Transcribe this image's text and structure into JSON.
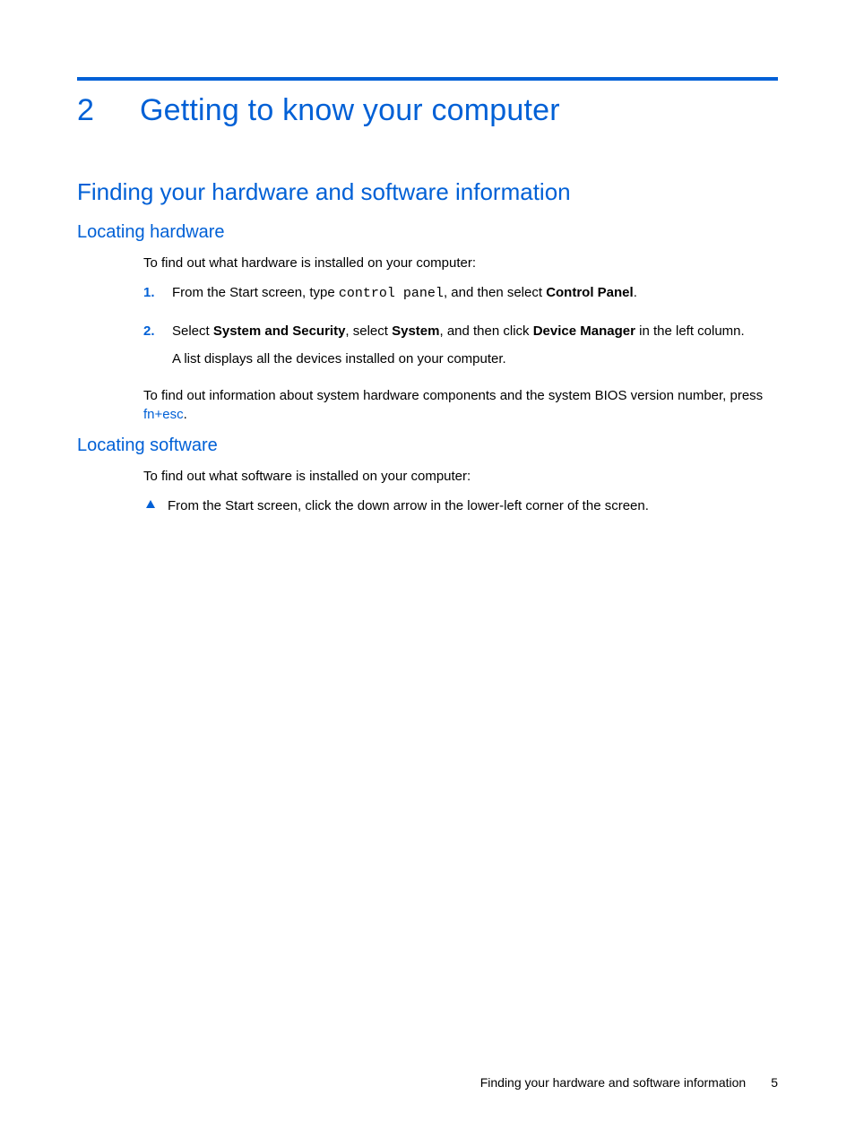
{
  "chapter": {
    "number": "2",
    "title": "Getting to know your computer"
  },
  "section1": {
    "title": "Finding your hardware and software information"
  },
  "sub_hw": {
    "title": "Locating hardware",
    "intro": "To find out what hardware is installed on your computer:",
    "step1_marker": "1.",
    "step1_a": "From the Start screen, type ",
    "step1_code": "control panel",
    "step1_b": ", and then select ",
    "step1_bold": "Control Panel",
    "step1_c": ".",
    "step2_marker": "2.",
    "step2_a": "Select ",
    "step2_b1": "System and Security",
    "step2_b": ", select ",
    "step2_b2": "System",
    "step2_c": ", and then click ",
    "step2_b3": "Device Manager",
    "step2_d": " in the left column.",
    "step2_para2": "A list displays all the devices installed on your computer.",
    "outro_a": "To find out information about system hardware components and the system BIOS version number, press ",
    "key_fn": "fn",
    "plus": "+",
    "key_esc": "esc",
    "outro_b": "."
  },
  "sub_sw": {
    "title": "Locating software",
    "intro": "To find out what software is installed on your computer:",
    "bullet": "From the Start screen, click the down arrow in the lower-left corner of the screen."
  },
  "footer": {
    "section": "Finding your hardware and software information",
    "page": "5"
  }
}
